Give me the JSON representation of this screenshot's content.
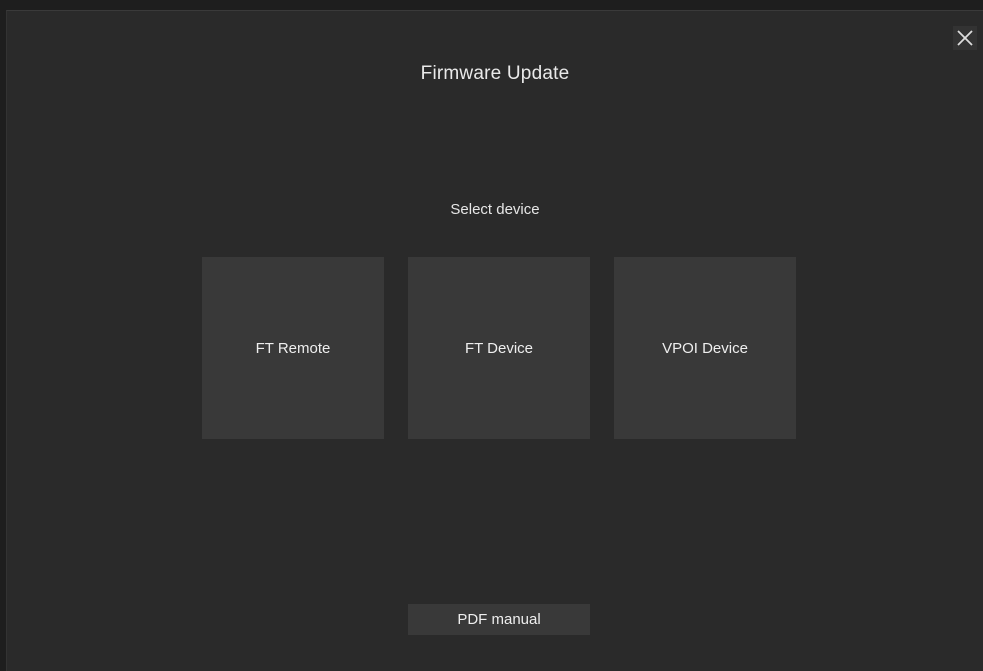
{
  "dialog": {
    "title": "Firmware Update",
    "subtitle": "Select device",
    "close_icon": "close-icon"
  },
  "devices": [
    {
      "label": "FT Remote"
    },
    {
      "label": "FT Device"
    },
    {
      "label": "VPOI Device"
    }
  ],
  "footer": {
    "pdf_label": "PDF manual"
  }
}
